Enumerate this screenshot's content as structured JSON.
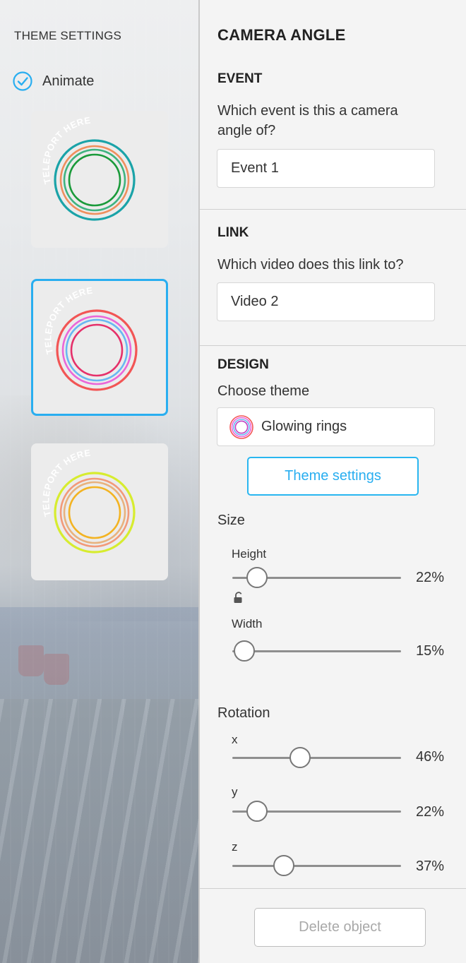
{
  "theme_settings_panel": {
    "title": "THEME SETTINGS",
    "animate": {
      "label": "Animate",
      "checked": true
    },
    "themes": [
      {
        "ring_text": "TELEPORT HERE",
        "selected": false,
        "ring_colors": [
          "#1aa3a8",
          "#ef8f5d",
          "#3fb37f",
          "#1a9a3a"
        ]
      },
      {
        "ring_text": "TELEPORT HERE",
        "selected": true,
        "ring_colors": [
          "#f25555",
          "#ea66d8",
          "#69b7f2",
          "#e5306a"
        ]
      },
      {
        "ring_text": "TELEPORT HERE",
        "selected": false,
        "ring_colors": [
          "#d7ec2f",
          "#f29a7a",
          "#e8b27e",
          "#f3b322"
        ]
      }
    ]
  },
  "camera_angle_panel": {
    "title": "CAMERA ANGLE",
    "event": {
      "heading": "EVENT",
      "question": "Which event is this a camera angle of?",
      "value": "Event 1"
    },
    "link": {
      "heading": "LINK",
      "question": "Which video does this link to?",
      "value": "Video 2"
    },
    "design": {
      "heading": "DESIGN",
      "choose_label": "Choose theme",
      "selected_theme": "Glowing rings",
      "theme_settings_button": "Theme settings"
    },
    "size": {
      "label": "Size",
      "height": {
        "label": "Height",
        "value": 0.22,
        "display": "22%"
      },
      "aspect_lock_icon": "unlocked-padlock-icon",
      "width": {
        "label": "Width",
        "value": 0.15,
        "display": "15%"
      }
    },
    "rotation": {
      "label": "Rotation",
      "x": {
        "label": "x",
        "value": 0.46,
        "display": "46%"
      },
      "y": {
        "label": "y",
        "value": 0.22,
        "display": "22%"
      },
      "z": {
        "label": "z",
        "value": 0.37,
        "display": "37%"
      }
    },
    "delete_button": "Delete object"
  },
  "colors": {
    "accent": "#29aef0",
    "panel": "#f4f4f4",
    "slider_track": "#8e8e8e"
  }
}
